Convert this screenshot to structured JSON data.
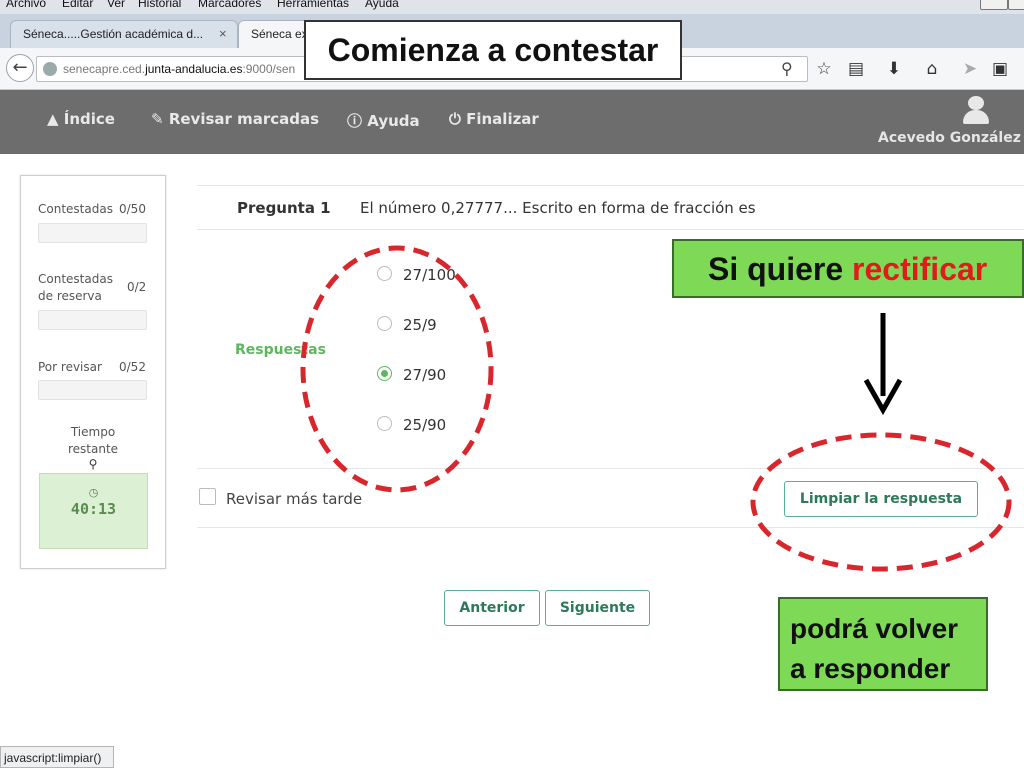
{
  "browser": {
    "menu": [
      "Archivo",
      "Editar",
      "Ver",
      "Historial",
      "Marcadores",
      "Herramientas",
      "Ayuda"
    ],
    "tabs": [
      {
        "label": "Séneca.....Gestión académica d...",
        "close": "×"
      },
      {
        "label": "Séneca ex"
      }
    ],
    "url": {
      "host": "senecapre.ced.",
      "domain": "junta-andalucia.es",
      "rest": ":9000/sen"
    },
    "status_text": "javascript:limpiar()"
  },
  "app": {
    "nav": {
      "index": "Índice",
      "review_marked": "Revisar marcadas",
      "help": "Ayuda",
      "finish": "Finalizar"
    },
    "user_name": "Acevedo González"
  },
  "sidebar": {
    "answered": {
      "label": "Contestadas",
      "value": "0/50"
    },
    "reserve": {
      "label_line1": "Contestadas",
      "label_line2": "de reserva",
      "value": "0/2"
    },
    "to_review": {
      "label": "Por revisar",
      "value": "0/52"
    },
    "time_label_line1": "Tiempo",
    "time_label_line2": "restante",
    "time_value": "40:13"
  },
  "question": {
    "label": "Pregunta 1",
    "text": "El número 0,27777... Escrito en forma de fracción es",
    "answers_label": "Respuestas",
    "options": [
      "27/100",
      "25/9",
      "27/90",
      "25/90"
    ],
    "selected_index": 2,
    "review_later": "Revisar más tarde",
    "clear_button": "Limpiar la respuesta"
  },
  "pager": {
    "prev": "Anterior",
    "next": "Siguiente"
  },
  "annotations": {
    "title": "Comienza a contestar",
    "rectify_prefix": "Si quiere ",
    "rectify_word": "rectificar",
    "answer_again_line1": "podrá volver",
    "answer_again_line2": "a responder"
  },
  "colors": {
    "accent_green": "#5cb85c",
    "callout_green": "#7ed957",
    "highlight_red": "#e01b1b",
    "dashed_red": "#d9262c"
  }
}
